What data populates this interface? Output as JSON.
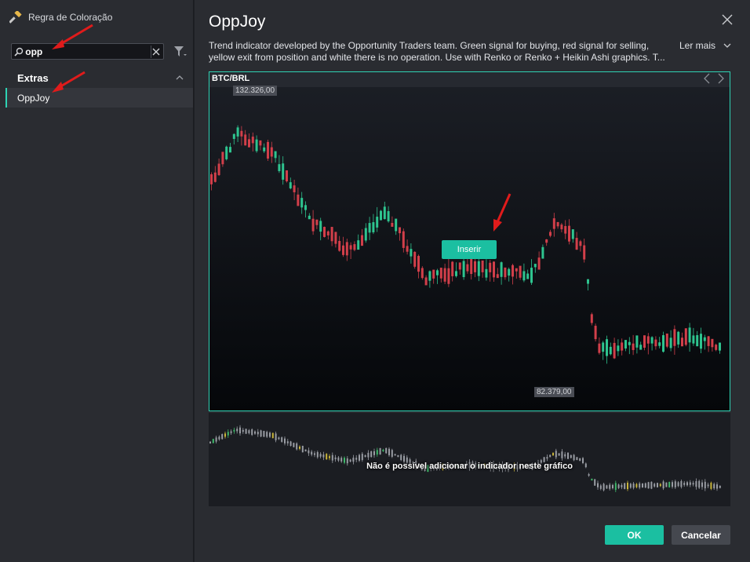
{
  "window": {
    "title": "Regra de Coloração"
  },
  "search": {
    "value": "opp"
  },
  "sidebar": {
    "group": "Extras",
    "items": [
      {
        "label": "OppJoy"
      }
    ]
  },
  "indicator": {
    "title": "OppJoy",
    "description": "Trend indicator developed by the Opportunity Traders team. Green signal for buying, red signal for selling, yellow exit from position and white there is no operation. Use with Renko or Renko + Heikin Ashi graphics. T...",
    "read_more": "Ler mais"
  },
  "chart": {
    "symbol": "BTC/BRL",
    "high_label": "132.326,00",
    "low_label": "82.379,00",
    "insert_label": "Inserir",
    "colors": {
      "up": "#2ec48f",
      "down": "#d23f4a",
      "border": "#2ed3b4"
    }
  },
  "preview": {
    "message": "Não é possível adicionar o indicador neste gráfico"
  },
  "footer": {
    "ok_label": "OK",
    "cancel_label": "Cancelar"
  }
}
